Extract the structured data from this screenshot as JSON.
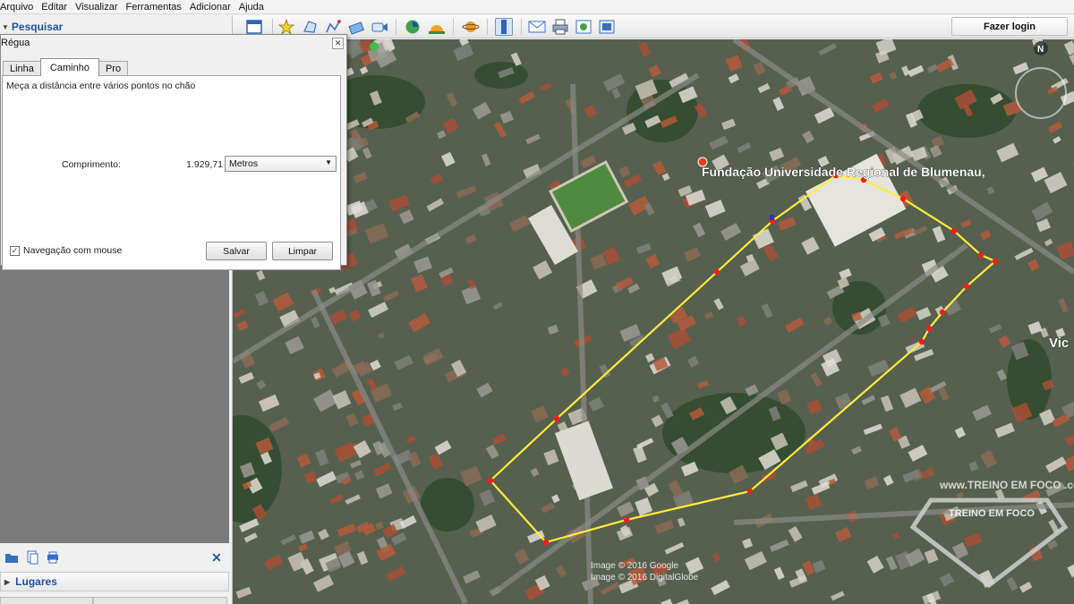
{
  "menu": [
    "Arquivo",
    "Editar",
    "Visualizar",
    "Ferramentas",
    "Adicionar",
    "Ajuda"
  ],
  "sidebar": {
    "search_label": "Pesquisar",
    "places_label": "Lugares"
  },
  "login_button": "Fazer login",
  "dialog": {
    "title": "Régua",
    "tabs": [
      "Linha",
      "Caminho",
      "Pro"
    ],
    "active_tab": "Caminho",
    "description": "Meça a distância entre vários pontos no chão",
    "length_label": "Comprimento:",
    "length_value": "1.929,71",
    "unit": "Metros",
    "mouse_nav_label": "Navegação com mouse",
    "mouse_nav_checked": true,
    "save_button": "Salvar",
    "clear_button": "Limpar"
  },
  "map": {
    "place_label": "Fundação Universidade Regional de Blumenau,",
    "edge_label": "Vic",
    "credit_1": "Image © 2016 Google",
    "credit_2": "Image © 2016 DigitalGlobe",
    "north": "N",
    "watermark_url": "www.TREINO EM FOCO .com.br",
    "watermark_logo": "TREINO EM FOCO",
    "path_color": "#ffeb3b",
    "vertex_color": "#ff1a1a",
    "icons": [
      "compass-icon",
      "pushpin-icon",
      "school-icon"
    ]
  },
  "toolbar": {
    "icons": [
      "sidebar-toggle-icon",
      "add-placemark-icon",
      "add-polygon-icon",
      "add-path-icon",
      "add-overlay-icon",
      "record-tour-icon",
      "historical-imagery-icon",
      "sunlight-icon",
      "planets-icon",
      "ruler-icon",
      "email-icon",
      "print-icon",
      "view-in-maps-icon"
    ],
    "colors": {
      "bar": "#eeeeee"
    }
  }
}
